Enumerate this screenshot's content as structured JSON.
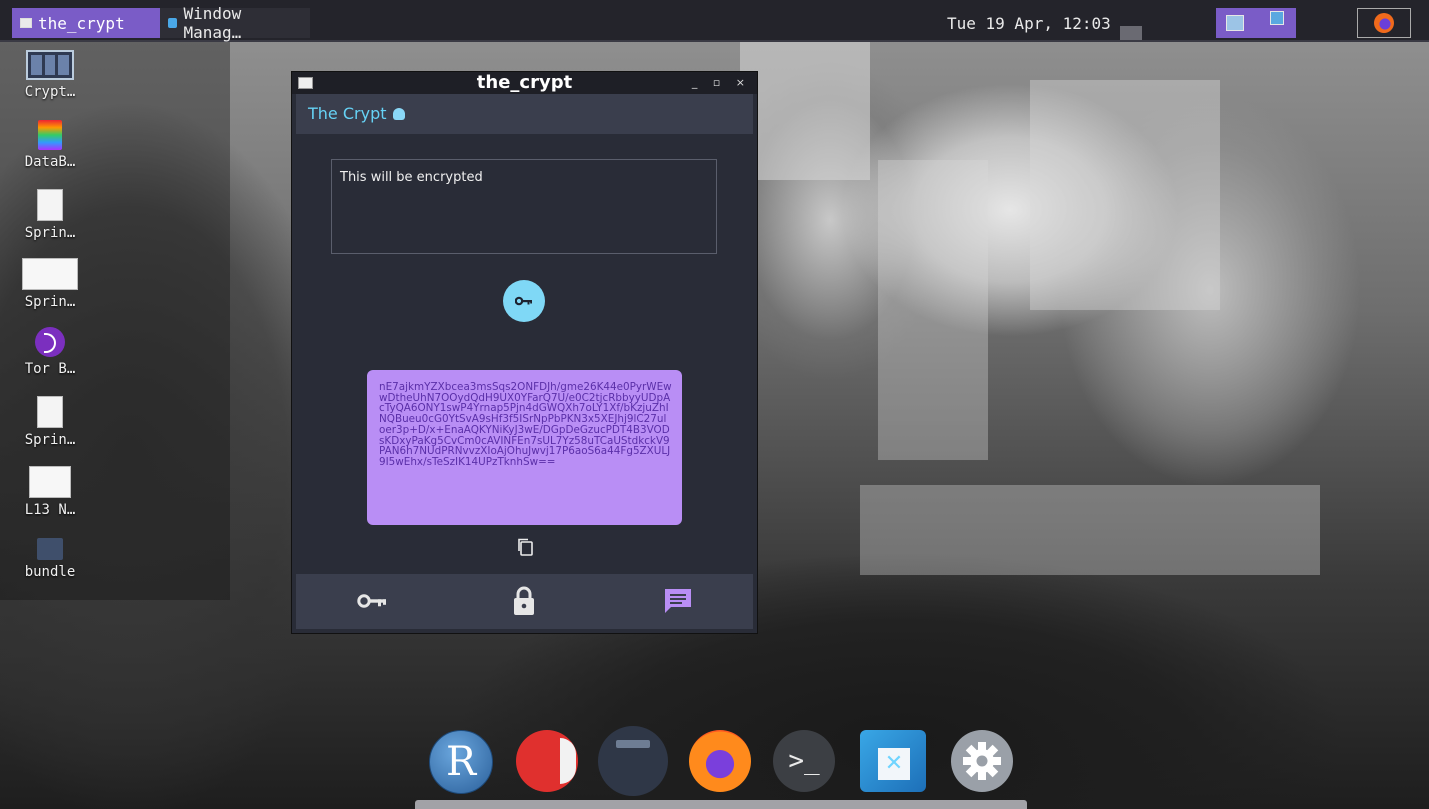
{
  "taskbar": {
    "tasks": [
      {
        "label": "the_crypt",
        "active": true
      },
      {
        "label": "Window Manag…",
        "active": false
      }
    ],
    "clock": "Tue 19 Apr, 12:03"
  },
  "desktop_icons": [
    {
      "label": "Crypt…",
      "icon": "app-grid-icon"
    },
    {
      "label": "DataB…",
      "icon": "database-app-icon"
    },
    {
      "label": "Sprin…",
      "icon": "document-icon"
    },
    {
      "label": "Sprin…",
      "icon": "document-wide-icon"
    },
    {
      "label": "Tor B…",
      "icon": "tor-browser-icon"
    },
    {
      "label": "Sprin…",
      "icon": "document-icon"
    },
    {
      "label": "L13 N…",
      "icon": "document-wide-icon"
    },
    {
      "label": "bundle",
      "icon": "folder-icon"
    }
  ],
  "window": {
    "title": "the_crypt",
    "controls": "_ ▫ ×",
    "app_title": "The Crypt",
    "input_text": "This will be encrypted",
    "output_text": "nE7ajkmYZXbcea3msSqs2ONFDJh/gme26K44e0PyrWEwwDtheUhN7OOydQdH9UX0YFarQ7U/e0C2tjcRbbyyUDpAcTyQA6ONY1swP4Yrnap5Pjn4dGWQXh7oLY1Xf/bKzjuZhINQBueu0cG0YtSvA9sHf3f5ISrNpPbPKN3x5XEJhj9lC27uloer3p+D/x+EnaAQKYNiKyJ3wE/DGpDeGzucPDT4B3VODsKDxyPaKg5CvCm0cAVINFEn7sUL7Yz58uTCaUStdkckV9PAN6h7NUdPRNvvzXIoAjOhuJwvj17P6aoS6a44Fg5ZXULJ9I5wEhx/sTeSzIK14UPzTknhSw=="
  },
  "dock": [
    "R",
    "pdf-reader-icon",
    "files-icon",
    "firefox-icon",
    ">_",
    "window-manager-icon",
    "settings-icon"
  ],
  "colors": {
    "accent": "#7a5cc7",
    "key_button": "#7fd8f6",
    "bubble": "#b98ef5",
    "header_text": "#66d2f5",
    "nav_active": "#b98ef5"
  }
}
